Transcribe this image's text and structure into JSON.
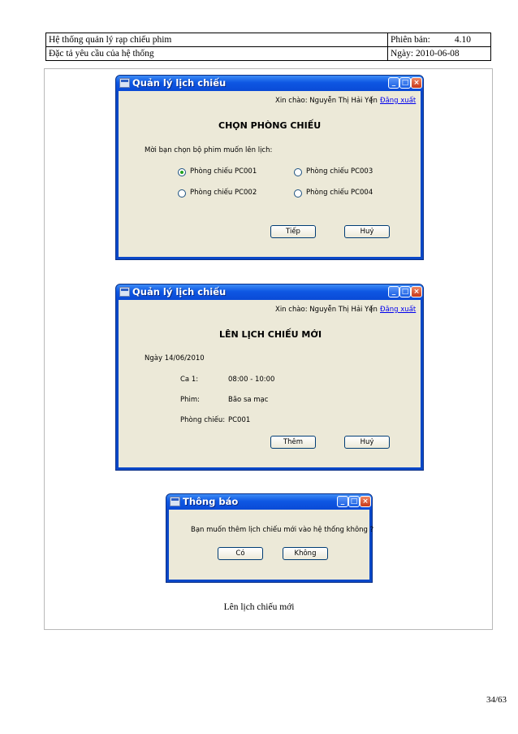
{
  "header": {
    "system_name": "Hệ thống quản lý rạp chiếu phim",
    "version_label": "Phiên bản:",
    "version_value": "4.10",
    "doc_title": "Đặc tả yêu cầu của hệ thống",
    "date_label": "Ngày:",
    "date_value": "2010-06-08"
  },
  "window1": {
    "title": "Quản lý lịch chiếu",
    "greeting": "Xin chào: Nguyễn Thị Hải Yến",
    "separator": "|",
    "logout": "Đăng xuất",
    "heading": "CHỌN PHÒNG CHIẾU",
    "prompt": "Mời bạn chọn bộ phim muốn lên lịch:",
    "rooms": [
      "Phòng chiếu PC001",
      "Phòng chiếu PC003",
      "Phòng chiếu PC002",
      "Phòng chiếu PC004"
    ],
    "selected_room": "Phòng chiếu PC001",
    "next_button": "Tiếp",
    "cancel_button": "Huỷ"
  },
  "window2": {
    "title": "Quản lý lịch chiếu",
    "greeting": "Xin chào: Nguyễn Thị Hải Yến",
    "separator": "|",
    "logout": "Đăng xuất",
    "heading": "LÊN LỊCH CHIẾU MỚI",
    "date_line": "Ngày 14/06/2010",
    "shift_label": "Ca 1:",
    "shift_value": "08:00 - 10:00",
    "movie_label": "Phim:",
    "movie_value": "Bão sa mạc",
    "room_label": "Phòng chiếu:",
    "room_value": "PC001",
    "add_button": "Thêm",
    "cancel_button": "Huỷ"
  },
  "window3": {
    "title": "Thông báo",
    "message": "Bạn muốn thêm lịch chiếu mới vào hệ thống không ?",
    "yes_button": "Có",
    "no_button": "Không"
  },
  "caption": "Lên lịch chiếu mới",
  "page_number": "34/63",
  "colors": {
    "titlebar": "#0e57e3",
    "window_body": "#ece9d8",
    "link": "#0000ee",
    "radio_selected": "#21a121"
  },
  "icons": [
    "app-icon",
    "minimize-icon",
    "maximize-icon",
    "close-icon"
  ]
}
